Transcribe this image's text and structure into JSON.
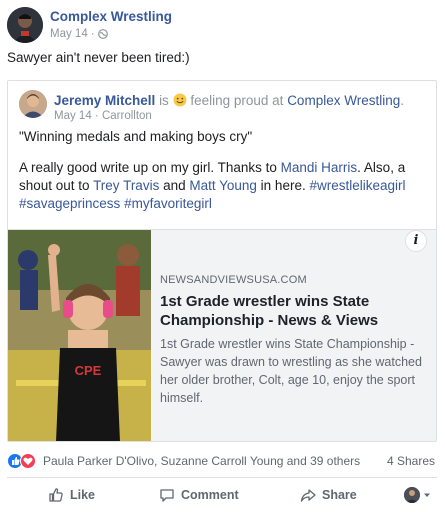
{
  "post": {
    "page_name": "Complex Wrestling",
    "date": "May 14",
    "separator": "·",
    "text": "Sawyer ain't never been tired:)"
  },
  "shared": {
    "author": "Jeremy Mitchell",
    "is_word": "is",
    "feeling": "feeling proud at",
    "page": "Complex Wrestling",
    "period": ".",
    "date": "May 14",
    "separator": "·",
    "location": "Carrollton",
    "quote": "\"Winning medals and making boys cry\"",
    "body": {
      "part1": "A really good write up on my girl. Thanks to ",
      "mention1": "Mandi Harris",
      "part2": ". Also, a shout out to ",
      "mention2": "Trey Travis",
      "part3": " and ",
      "mention3": "Matt Young",
      "part4": " in here. ",
      "tag1": "#wrestlelikeagirl",
      "tag2": "#savageprincess",
      "tag3": "#myfavoritegirl"
    }
  },
  "link_preview": {
    "domain": "NEWSANDVIEWSUSA.COM",
    "headline": "1st Grade wrestler wins State Championship - News & Views",
    "description": "1st Grade wrestler wins State Championship - Sawyer was drawn to wrestling as she watched her older brother, Colt, age 10, enjoy the sport himself.",
    "info_icon": "i",
    "image_singlet_text": "CPE"
  },
  "reactions": {
    "names": "Paula Parker D'Olivo, Suzanne Carroll Young and 39 others",
    "shares": "4 Shares",
    "icons": [
      "like-reaction",
      "love-reaction"
    ]
  },
  "actions": {
    "like": "Like",
    "comment": "Comment",
    "share": "Share"
  },
  "colors": {
    "link": "#385898",
    "meta": "#90949c",
    "like_blue": "#1877f2",
    "love_red": "#f33e58"
  }
}
